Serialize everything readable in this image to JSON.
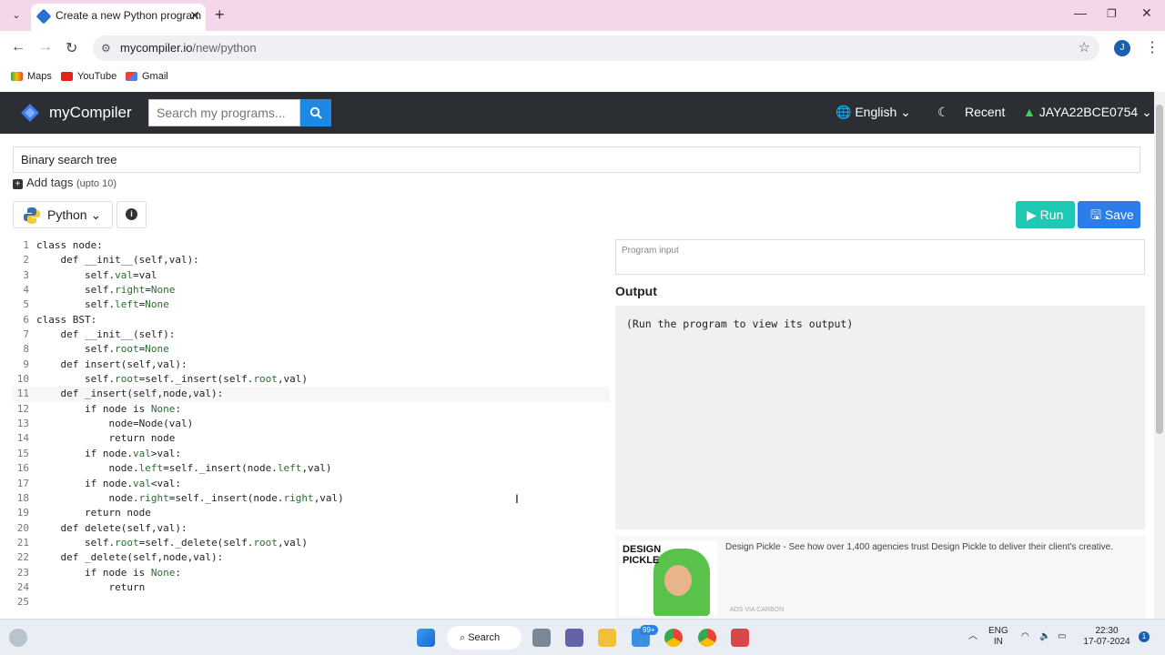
{
  "browser": {
    "tab_title": "Create a new Python program",
    "url_host": "mycompiler.io",
    "url_path": "/new/python",
    "profile_initial": "J",
    "new_tab_label": "+",
    "bookmarks": [
      "Maps",
      "YouTube",
      "Gmail"
    ]
  },
  "header": {
    "brand": "myCompiler",
    "search_placeholder": "Search my programs...",
    "language": "English",
    "recent": "Recent",
    "username": "JAYA22BCE0754"
  },
  "program": {
    "title": "Binary search tree",
    "add_tags": "Add tags",
    "tags_note": "(upto 10)",
    "language": "Python",
    "run_label": "Run",
    "save_label": "Save"
  },
  "editor": {
    "active_line": 11,
    "lines": [
      "class node:",
      "    def __init__(self,val):",
      "        self.val=val",
      "        self.right=None",
      "        self.left=None",
      "class BST:",
      "    def __init__(self):",
      "        self.root=None",
      "    def insert(self,val):",
      "        self.root=self._insert(self.root,val)",
      "    def _insert(self,node,val):",
      "        if node is None:",
      "            node=Node(val)",
      "            return node",
      "        if node.val>val:",
      "            node.left=self._insert(node.left,val)",
      "        if node.val<val:",
      "            node.right=self._insert(node.right,val)",
      "        return node",
      "    def delete(self,val):",
      "        self.root=self._delete(self.root,val)",
      "    def _delete(self,node,val):",
      "        if node is None:",
      "            return",
      ""
    ]
  },
  "io": {
    "input_placeholder": "Program input",
    "output_label": "Output",
    "output_text": "(Run the program to view its output)"
  },
  "ad": {
    "brand_line1": "DESIGN",
    "brand_line2": "PICKLE",
    "text": "Design Pickle - See how over 1,400 agencies trust Design Pickle to deliver their client's creative.",
    "via": "ADS VIA CARBON"
  },
  "taskbar": {
    "search": "Search",
    "mail_badge": "99+",
    "lang_line1": "ENG",
    "lang_line2": "IN",
    "time": "22:30",
    "date": "17-07-2024",
    "notification_count": "1"
  },
  "colors": {
    "header_bg": "#2b2e33",
    "run_green": "#1fc7b5",
    "save_blue": "#2b7de9",
    "tab_strip": "#f5d7ec"
  }
}
